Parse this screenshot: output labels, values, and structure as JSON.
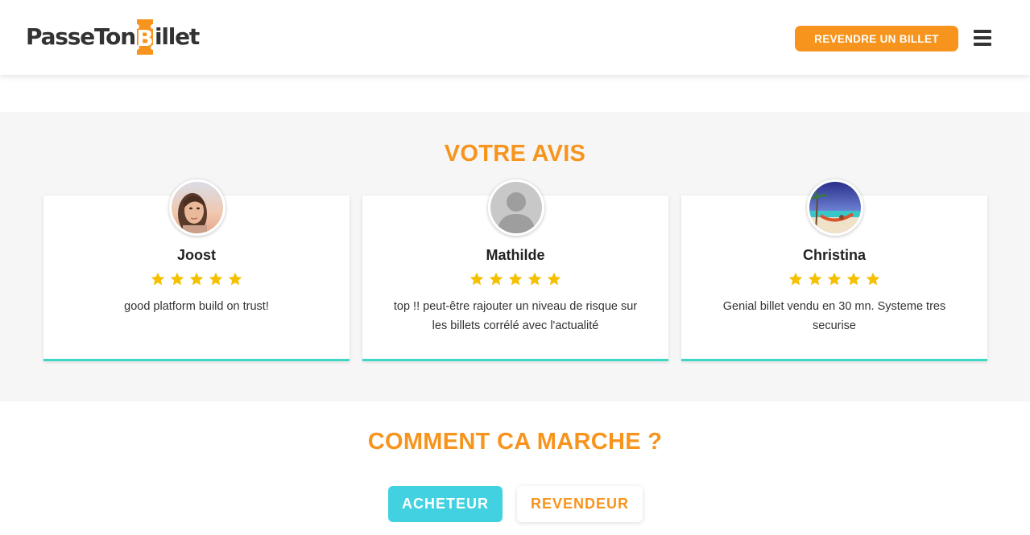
{
  "header": {
    "logo": {
      "part1": "PasseTon",
      "b_letter": "B",
      "part2": "illet"
    },
    "resell_button_label": "REVENDRE UN BILLET",
    "menu_icon": "hamburger-menu-icon"
  },
  "colors": {
    "accent_orange": "#f7941d",
    "card_border_teal": "#3ed7c3",
    "buyer_tab_cyan": "#41d1e0",
    "star_yellow": "#f5c000",
    "section_bg": "#f5f6f5"
  },
  "reviews": {
    "title": "VOTRE AVIS",
    "items": [
      {
        "name": "Joost",
        "rating": 5,
        "text": "good platform build on trust!",
        "avatar_icon": "user-photo-avatar"
      },
      {
        "name": "Mathilde",
        "rating": 5,
        "text": "top !! peut-être rajouter un niveau de risque sur les billets corrélé avec l'actualité",
        "avatar_icon": "default-user-avatar"
      },
      {
        "name": "Christina",
        "rating": 5,
        "text": "Genial billet vendu en 30 mn. Systeme tres securise",
        "avatar_icon": "beach-hammock-avatar"
      }
    ]
  },
  "how_it_works": {
    "title": "COMMENT CA MARCHE ?",
    "tabs": [
      {
        "label": "ACHETEUR",
        "active": true
      },
      {
        "label": "REVENDEUR",
        "active": false
      }
    ]
  }
}
